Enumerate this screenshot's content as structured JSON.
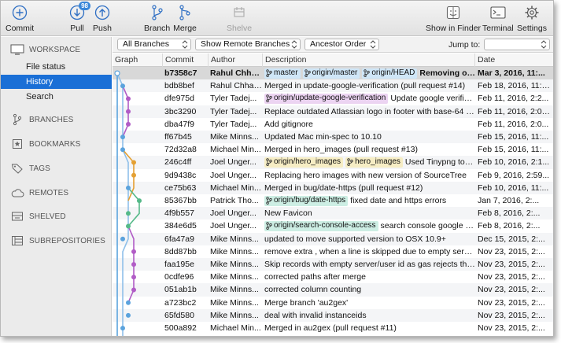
{
  "toolbar": {
    "commit": "Commit",
    "pull": "Pull",
    "pull_badge": "98",
    "push": "Push",
    "branch": "Branch",
    "merge": "Merge",
    "shelve": "Shelve",
    "show_in_finder": "Show in Finder",
    "terminal": "Terminal",
    "settings": "Settings"
  },
  "sidebar": {
    "workspace": "WORKSPACE",
    "workspace_items": [
      "File status",
      "History",
      "Search"
    ],
    "branches": "BRANCHES",
    "bookmarks": "BOOKMARKS",
    "tags": "TAGS",
    "remotes": "REMOTES",
    "shelved": "SHELVED",
    "subrepositories": "SUBREPOSITORIES"
  },
  "filter": {
    "branches": "All Branches",
    "remote": "Show Remote Branches",
    "order": "Ancestor Order",
    "jump_label": "Jump to:"
  },
  "columns": {
    "graph": "Graph",
    "commit": "Commit",
    "author": "Author",
    "description": "Description",
    "date": "Date"
  },
  "colors": {
    "tag_blue": "#cfe6f7",
    "tag_purple": "#ecd4f2",
    "tag_yellow": "#f6edc4",
    "tag_green": "#cdeee4",
    "selection": "#1a6fd6",
    "lane_blue": "#5ba3dd",
    "lane_purple": "#b15cc6",
    "lane_green": "#55b988",
    "lane_orange": "#e4a033"
  },
  "commits": [
    {
      "hash": "b7358c7",
      "author": "Rahul Chhab...",
      "tags": [
        {
          "label": "master",
          "color": "blue"
        },
        {
          "label": "origin/master",
          "color": "blue"
        },
        {
          "label": "origin/HEAD",
          "color": "blue"
        }
      ],
      "message": "Removing ol...",
      "date": "Mar 3, 2016, 11:..."
    },
    {
      "hash": "bdb8bef",
      "author": "Rahul Chhab...",
      "tags": [],
      "message": "Merged in update-google-verification (pull request #14)",
      "date": "Feb 18, 2016, 11:28..."
    },
    {
      "hash": "dfe975d",
      "author": "Tyler Tadej...",
      "tags": [
        {
          "label": "origin/update-google-verification",
          "color": "purple"
        }
      ],
      "message": "Update google verificati...",
      "date": "Feb 11, 2016, 2:2..."
    },
    {
      "hash": "3bc3290",
      "author": "Tyler Tadej...",
      "tags": [],
      "message": "Replace outdated Atlassian logo in footer with base-64 en...",
      "date": "Feb 11, 2016, 2:08..."
    },
    {
      "hash": "dba47f9",
      "author": "Tyler Tadej...",
      "tags": [],
      "message": "Add gitignore",
      "date": "Feb 11, 2016, 2:0..."
    },
    {
      "hash": "ff67b45",
      "author": "Mike Minns...",
      "tags": [],
      "message": "Updated Mac min-spec to 10.10",
      "date": "Feb 15, 2016, 11:..."
    },
    {
      "hash": "72d32a8",
      "author": "Michael Min...",
      "tags": [],
      "message": "Merged in hero_images (pull request #13)",
      "date": "Feb 15, 2016, 11:..."
    },
    {
      "hash": "246c4ff",
      "author": "Joel Unger...",
      "tags": [
        {
          "label": "origin/hero_images",
          "color": "yellow"
        },
        {
          "label": "hero_images",
          "color": "yellow"
        }
      ],
      "message": "Used Tinypng to c...",
      "date": "Feb 10, 2016, 2:1..."
    },
    {
      "hash": "9d9438c",
      "author": "Joel Unger...",
      "tags": [],
      "message": "Replacing hero images with new version of SourceTree",
      "date": "Feb 9, 2016, 2:59..."
    },
    {
      "hash": "ce75b63",
      "author": "Michael Min...",
      "tags": [],
      "message": "Merged in bug/date-https (pull request #12)",
      "date": "Feb 10, 2016, 11:..."
    },
    {
      "hash": "85367bb",
      "author": "Patrick Tho...",
      "tags": [
        {
          "label": "origin/bug/date-https",
          "color": "green"
        }
      ],
      "message": "fixed date and https errors",
      "date": "Jan 7, 2016, 2:..."
    },
    {
      "hash": "4f9b557",
      "author": "Joel Unger...",
      "tags": [],
      "message": "New Favicon",
      "date": "Feb 8, 2016, 2:..."
    },
    {
      "hash": "384e6d5",
      "author": "Joel Unger...",
      "tags": [
        {
          "label": "origin/search-console-access",
          "color": "green"
        }
      ],
      "message": "search console google ver...",
      "date": "Feb 8, 2016, 2:..."
    },
    {
      "hash": "6fa47a9",
      "author": "Mike Minns...",
      "tags": [],
      "message": "updated to move supported version to OSX 10.9+",
      "date": "Dec 15, 2015, 2:..."
    },
    {
      "hash": "8dd87bb",
      "author": "Mike Minns...",
      "tags": [],
      "message": "remove extra , when a line is skipped due to empty server",
      "date": "Nov 23, 2015, 2:..."
    },
    {
      "hash": "faa195e",
      "author": "Mike Minns...",
      "tags": [],
      "message": "Skip records with empty server/user id as gas rejects them",
      "date": "Nov 23, 2015, 2:..."
    },
    {
      "hash": "0cdfe96",
      "author": "Mike Minns...",
      "tags": [],
      "message": "corrected paths after merge",
      "date": "Nov 23, 2015, 2:..."
    },
    {
      "hash": "051ab1b",
      "author": "Mike Minns...",
      "tags": [],
      "message": " corrected column counting",
      "date": "Nov 23, 2015, 2:..."
    },
    {
      "hash": "a723bc2",
      "author": "Mike Minns...",
      "tags": [],
      "message": "Merge branch 'au2gex'",
      "date": "Nov 23, 2015, 2:..."
    },
    {
      "hash": "65fd580",
      "author": "Mike Minns...",
      "tags": [],
      "message": "deal with invalid instanceids",
      "date": "Nov 23, 2015, 2:..."
    },
    {
      "hash": "500a892",
      "author": "Michael Min...",
      "tags": [],
      "message": "Merged in au2gex (pull request #11)",
      "date": "Nov 23, 2015, 2:..."
    }
  ]
}
